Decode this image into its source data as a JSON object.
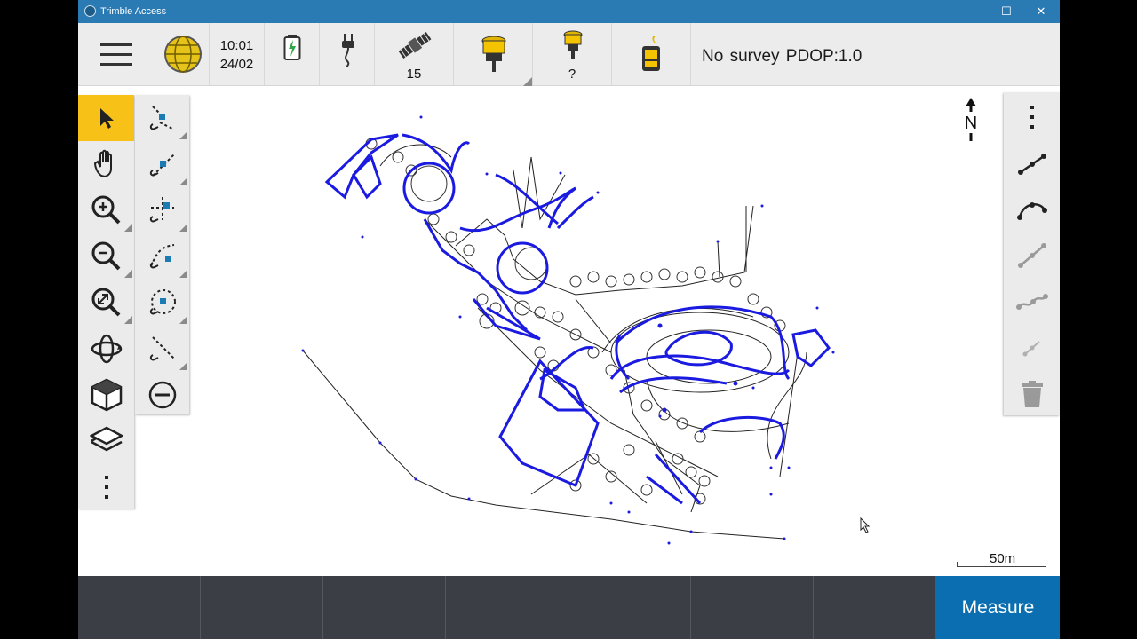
{
  "window": {
    "title": "Trimble Access",
    "minimize_glyph": "—",
    "maximize_glyph": "☐",
    "close_glyph": "✕"
  },
  "status_bar": {
    "time": "10:01",
    "date": "24/02",
    "satellites": "15",
    "radio_status": "?",
    "survey_status": "No survey  PDOP:1.0"
  },
  "map": {
    "scale_label": "50m",
    "north_label": "N"
  },
  "toolbar_left": {
    "items": [
      "select-tool",
      "pan-tool",
      "zoom-in",
      "zoom-out",
      "zoom-extents",
      "orbit",
      "view-3d",
      "layers",
      "more"
    ]
  },
  "toolbar_snap": {
    "items": [
      "snap-end",
      "snap-mid",
      "snap-center",
      "snap-intersect",
      "snap-arc-center",
      "snap-perpendicular",
      "clear-snap"
    ]
  },
  "toolbar_right": {
    "items": [
      "more-options",
      "draw-line",
      "draw-arc",
      "draw-polyline",
      "draw-curve",
      "measure-point",
      "delete"
    ]
  },
  "softkeys": {
    "measure_label": "Measure"
  },
  "colors": {
    "title_bar": "#2a7ab4",
    "accent_yellow": "#f7c117",
    "map_blue": "#1a1ae0",
    "softkey_bar": "#3b3e45",
    "measure_button": "#0a6eb0"
  }
}
